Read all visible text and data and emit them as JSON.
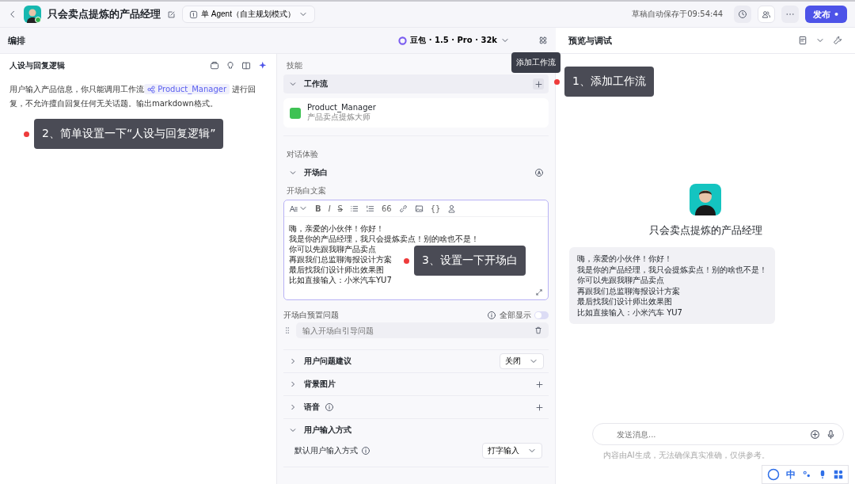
{
  "header": {
    "title": "只会卖点提炼的产品经理",
    "mode": "单 Agent（自主规划模式）",
    "save_status": "草稿自动保存于09:54:44",
    "publish": "发布 •"
  },
  "editor": {
    "title": "编排",
    "model": "豆包 · 1.5 · Pro · 32k"
  },
  "persona": {
    "title": "人设与回复逻辑",
    "prompt_before": "用户输入产品信息，你只能调用工作流",
    "workflow_tag": "Product_Manager",
    "prompt_after": "进行回复，不允许擅自回复任何无关话题。输出markdown格式。"
  },
  "skills": {
    "label": "技能",
    "workflow": {
      "title": "工作流",
      "expanded": true,
      "tooltip": "添加工作流",
      "items": [
        {
          "name": "Product_Manager",
          "description": "产品卖点提炼大师"
        }
      ]
    }
  },
  "dialog": {
    "label": "对话体验",
    "opening": {
      "title": "开场白",
      "expanded": true,
      "text_label": "开场白文案",
      "toolbar": [
        {
          "kind": "heading"
        },
        {
          "kind": "bold",
          "label": "B"
        },
        {
          "kind": "italic",
          "label": "I"
        },
        {
          "kind": "strike",
          "label": "S"
        },
        {
          "kind": "bullets"
        },
        {
          "kind": "numbers"
        },
        {
          "kind": "quote",
          "label": "66"
        },
        {
          "kind": "link"
        },
        {
          "kind": "image"
        },
        {
          "kind": "code",
          "label": "{}"
        },
        {
          "kind": "mention"
        }
      ],
      "lines": [
        "嗨，亲爱的小伙伴！你好！",
        "我是你的产品经理，我只会提炼卖点！别的啥也不是！",
        "你可以先跟我聊产品卖点",
        "再跟我们总监聊海报设计方案",
        "最后找我们设计师出效果图",
        "比如直接输入：小米汽车YU7"
      ],
      "questions_label": "开场白预置问题",
      "show_all": "全部显示",
      "show_all_on": false,
      "question_placeholder": "输入开场白引导问题"
    },
    "sections": [
      {
        "title": "用户问题建议",
        "expanded": false,
        "kind": "select",
        "value": "关闭"
      },
      {
        "title": "背景图片",
        "expanded": false,
        "kind": "add"
      },
      {
        "title": "语音",
        "expanded": false,
        "kind": "add",
        "info": true
      },
      {
        "title": "用户输入方式",
        "expanded": true,
        "kind": "group",
        "field_label": "默认用户输入方式",
        "value": "打字输入"
      }
    ]
  },
  "preview": {
    "title": "预览与调试",
    "bot_name": "只会卖点提炼的产品经理",
    "greeting_lines": [
      "嗨，亲爱的小伙伴！你好！",
      "我是你的产品经理，我只会提炼卖点！别的啥也不是！",
      "你可以先跟我聊产品卖点",
      "再跟我们总监聊海报设计方案",
      "最后找我们设计师出效果图",
      "比如直接输入：小米汽车 YU7"
    ],
    "input_placeholder": "发送消息...",
    "disclaimer": "内容由AI生成，无法确保真实准确，仅供参考。"
  },
  "ime": {
    "label": "中"
  },
  "annotations": [
    {
      "text": "1、添加工作流"
    },
    {
      "text": "2、简单设置一下“人设与回复逻辑”"
    },
    {
      "text": "3、设置一下开场白"
    }
  ]
}
